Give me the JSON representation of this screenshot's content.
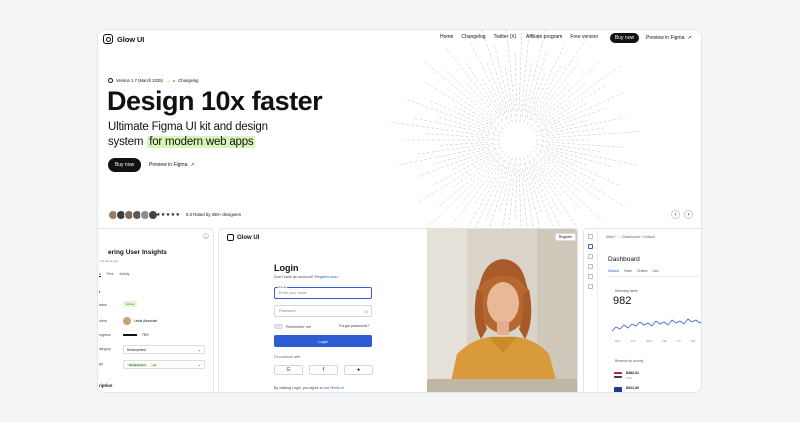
{
  "header": {
    "logo": "Glow UI",
    "nav": [
      "Home",
      "Changelog",
      "Twitter (X)",
      "Affiliate program",
      "Free version"
    ],
    "buy": "Buy now",
    "preview": "Preview in Figma"
  },
  "hero": {
    "version": "Version 1.7 (March 2025)",
    "changelog": "Changelog",
    "title": "Design 10x faster",
    "subtitle_line1": "Ultimate Figma UI kit and design",
    "subtitle_line2a": "system",
    "subtitle_line2b": "for modern web apps",
    "buy": "Buy now",
    "preview": "Preview in Figma",
    "stars": "★★★★★",
    "rating": "5.0 Rated by 350+ designers"
  },
  "card_left": {
    "title": "ering User Insights",
    "subtitle": "t 10 hours ago",
    "tabs": [
      "s",
      "Files",
      "Activity"
    ],
    "section": "t",
    "rows": [
      {
        "label": "tatus",
        "value": "Active"
      },
      {
        "label": "uthor",
        "value": "Leslie Alexander"
      },
      {
        "label": "rogress",
        "value": "75%"
      },
      {
        "label": "ategory",
        "value": "Development"
      },
      {
        "label": "gs",
        "value": "Development",
        "extra": "+2"
      }
    ],
    "footer": "ription"
  },
  "card_login": {
    "logo": "Glow UI",
    "register": "Register",
    "title": "Login",
    "no_account": "Don't have an account?",
    "register_now": "Register now",
    "email_label": "Email",
    "email_placeholder": "Enter your email",
    "password_placeholder": "Password",
    "remember": "Remember me",
    "forgot": "Forgot password?",
    "login_btn": "Login",
    "or": "Or continue with:",
    "terms": "By clicking Login, you agree to our",
    "terms_link": "Terms of"
  },
  "card_dashboard": {
    "crumb": "Main  /  ...  /  Dashboard  /  Default",
    "title": "Dashboard",
    "tabs": [
      "Default",
      "Team",
      "Orders",
      "Use"
    ],
    "kpi_label": "Returning users",
    "kpi": "982",
    "days": [
      "Mon",
      "Tue",
      "Wed",
      "Thu",
      "Fri",
      "Sat"
    ],
    "revenue_label": "Revenue by country",
    "rows": [
      {
        "amount": "$482,01",
        "country": "USA"
      },
      {
        "amount": "$321,00",
        "country": "GBR"
      }
    ]
  },
  "colors": {
    "accent": "#2f5bd3",
    "highlight": "#d8f5b8",
    "dark": "#111111"
  }
}
